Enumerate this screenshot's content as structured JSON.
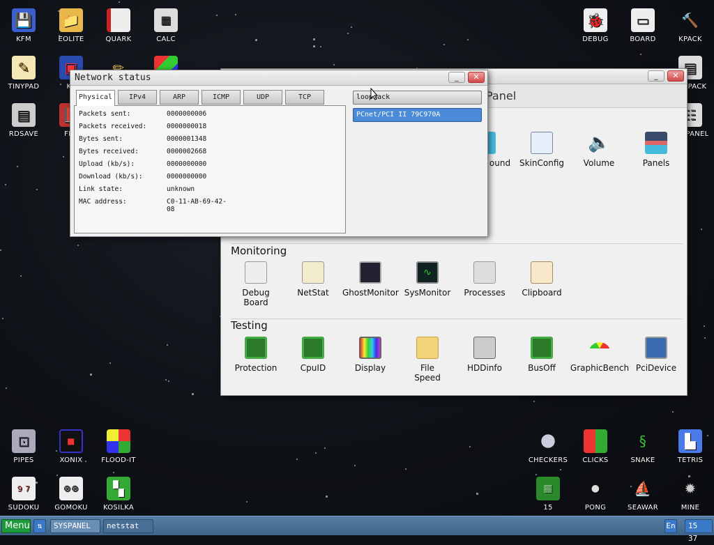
{
  "desktop": {
    "icons_left": [
      {
        "label": "KFM",
        "icon": "floppy-icon"
      },
      {
        "label": "EOLITE",
        "icon": "folder-icon"
      },
      {
        "label": "QUARK",
        "icon": "notebook-icon"
      },
      {
        "label": "CALC",
        "icon": "calculator-icon"
      },
      {
        "label": "TINYPAD",
        "icon": "notepad-icon"
      },
      {
        "label": "KF",
        "icon": "dock-icon"
      },
      {
        "label": "RDSAVE",
        "icon": "rdsave-icon"
      },
      {
        "label": "FB2",
        "icon": "book-icon"
      }
    ],
    "icons_right": [
      {
        "label": "DEBUG",
        "icon": "bug-icon"
      },
      {
        "label": "BOARD",
        "icon": "board-icon"
      },
      {
        "label": "KPACK",
        "icon": "hammer-icon"
      },
      {
        "label": "PACK",
        "icon": "cabinet-icon"
      },
      {
        "label": "PANEL",
        "icon": "settings-icon"
      }
    ],
    "games_left": [
      {
        "label": "PIPES",
        "icon": "pipes-icon"
      },
      {
        "label": "XONIX",
        "icon": "xonix-icon"
      },
      {
        "label": "FLOOD-IT",
        "icon": "flood-icon"
      },
      {
        "label": "SUDOKU",
        "icon": "sudoku-icon"
      },
      {
        "label": "GOMOKU",
        "icon": "gomoku-icon"
      },
      {
        "label": "KOSILKA",
        "icon": "mower-icon"
      }
    ],
    "games_right": [
      {
        "label": "CHECKERS",
        "icon": "checkers-icon"
      },
      {
        "label": "CLICKS",
        "icon": "clicks-icon"
      },
      {
        "label": "SNAKE",
        "icon": "snake-icon"
      },
      {
        "label": "TETRIS",
        "icon": "tetris-icon"
      },
      {
        "label": "15",
        "icon": "fifteen-icon"
      },
      {
        "label": "PONG",
        "icon": "pong-icon"
      },
      {
        "label": "SEAWAR",
        "icon": "ship-icon"
      },
      {
        "label": "MINE",
        "icon": "mine-icon"
      }
    ]
  },
  "netstat": {
    "title": "Network status",
    "tabs": [
      "Physical",
      "IPv4",
      "ARP",
      "ICMP",
      "UDP",
      "TCP"
    ],
    "active_tab": "Physical",
    "rows": [
      {
        "key": "Packets sent:",
        "val": "0000000006"
      },
      {
        "key": "Packets received:",
        "val": "0000000018"
      },
      {
        "key": "Bytes sent:",
        "val": "0000001348"
      },
      {
        "key": "Bytes received:",
        "val": "0000002668"
      },
      {
        "key": "Upload (kb/s):",
        "val": "0000000000"
      },
      {
        "key": "Download (kb/s):",
        "val": "0000000000"
      },
      {
        "key": "Link state:",
        "val": "unknown"
      },
      {
        "key": "MAC address:",
        "val": "C0-11-AB-69-42-08"
      }
    ],
    "interfaces": [
      "loopback",
      "PCnet/PCI II 79C970A"
    ],
    "selected_interface": "PCnet/PCI II 79C970A"
  },
  "syspanel": {
    "title_fragment": "Panel",
    "top_items": [
      {
        "label": "ound",
        "icon": "sound-icon"
      },
      {
        "label": "SkinConfig",
        "icon": "skinconfig-icon"
      },
      {
        "label": "Volume",
        "icon": "volume-icon"
      },
      {
        "label": "Panels",
        "icon": "panels-icon"
      }
    ],
    "sections": [
      {
        "title": "Monitoring",
        "items": [
          {
            "label": "Debug Board",
            "icon": "debugboard-icon"
          },
          {
            "label": "NetStat",
            "icon": "netstat-icon"
          },
          {
            "label": "GhostMonitor",
            "icon": "ghostmonitor-icon"
          },
          {
            "label": "SysMonitor",
            "icon": "sysmonitor-icon"
          },
          {
            "label": "Processes",
            "icon": "processes-icon"
          },
          {
            "label": "Clipboard",
            "icon": "clipboard-icon"
          }
        ]
      },
      {
        "title": "Testing",
        "items": [
          {
            "label": "Protection",
            "icon": "chip-icon"
          },
          {
            "label": "CpuID",
            "icon": "chip-icon"
          },
          {
            "label": "Display",
            "icon": "display-icon"
          },
          {
            "label": "File Speed",
            "icon": "folder-icon"
          },
          {
            "label": "HDDinfo",
            "icon": "hdd-icon"
          },
          {
            "label": "BusOff",
            "icon": "chip-icon"
          },
          {
            "label": "GraphicBench",
            "icon": "gauge-icon"
          },
          {
            "label": "PciDevice",
            "icon": "pci-icon"
          }
        ]
      }
    ]
  },
  "taskbar": {
    "menu_label": "Menu",
    "tasks": [
      "SYSPANEL",
      "netstat"
    ],
    "lang": "En",
    "clock": "15 37"
  },
  "colors": {
    "accent": "#4a8ad6",
    "menu_green": "#1f9a3a",
    "taskbar": "#4a6f96"
  }
}
